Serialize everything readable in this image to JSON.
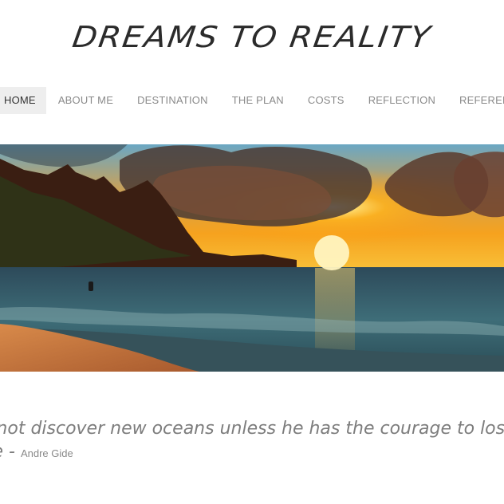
{
  "site": {
    "title": "DREAMS TO REALITY"
  },
  "nav": {
    "items": [
      {
        "label": "HOME",
        "active": true
      },
      {
        "label": "ABOUT ME",
        "active": false
      },
      {
        "label": "DESTINATION",
        "active": false
      },
      {
        "label": "THE PLAN",
        "active": false
      },
      {
        "label": "COSTS",
        "active": false
      },
      {
        "label": "REFLECTION",
        "active": false
      },
      {
        "label": "REFERENCES",
        "active": false
      }
    ]
  },
  "hero": {
    "image": "beach-sunset-photo"
  },
  "quote": {
    "line1": "annot discover new oceans unless he has the courage to lose",
    "line2": "ore - ",
    "author": "Andre Gide"
  },
  "colors": {
    "nav_active_bg": "#eeeeee",
    "nav_text": "#8a8a8a",
    "title": "#2b2b2b",
    "quote_text": "#7d7d7d"
  }
}
